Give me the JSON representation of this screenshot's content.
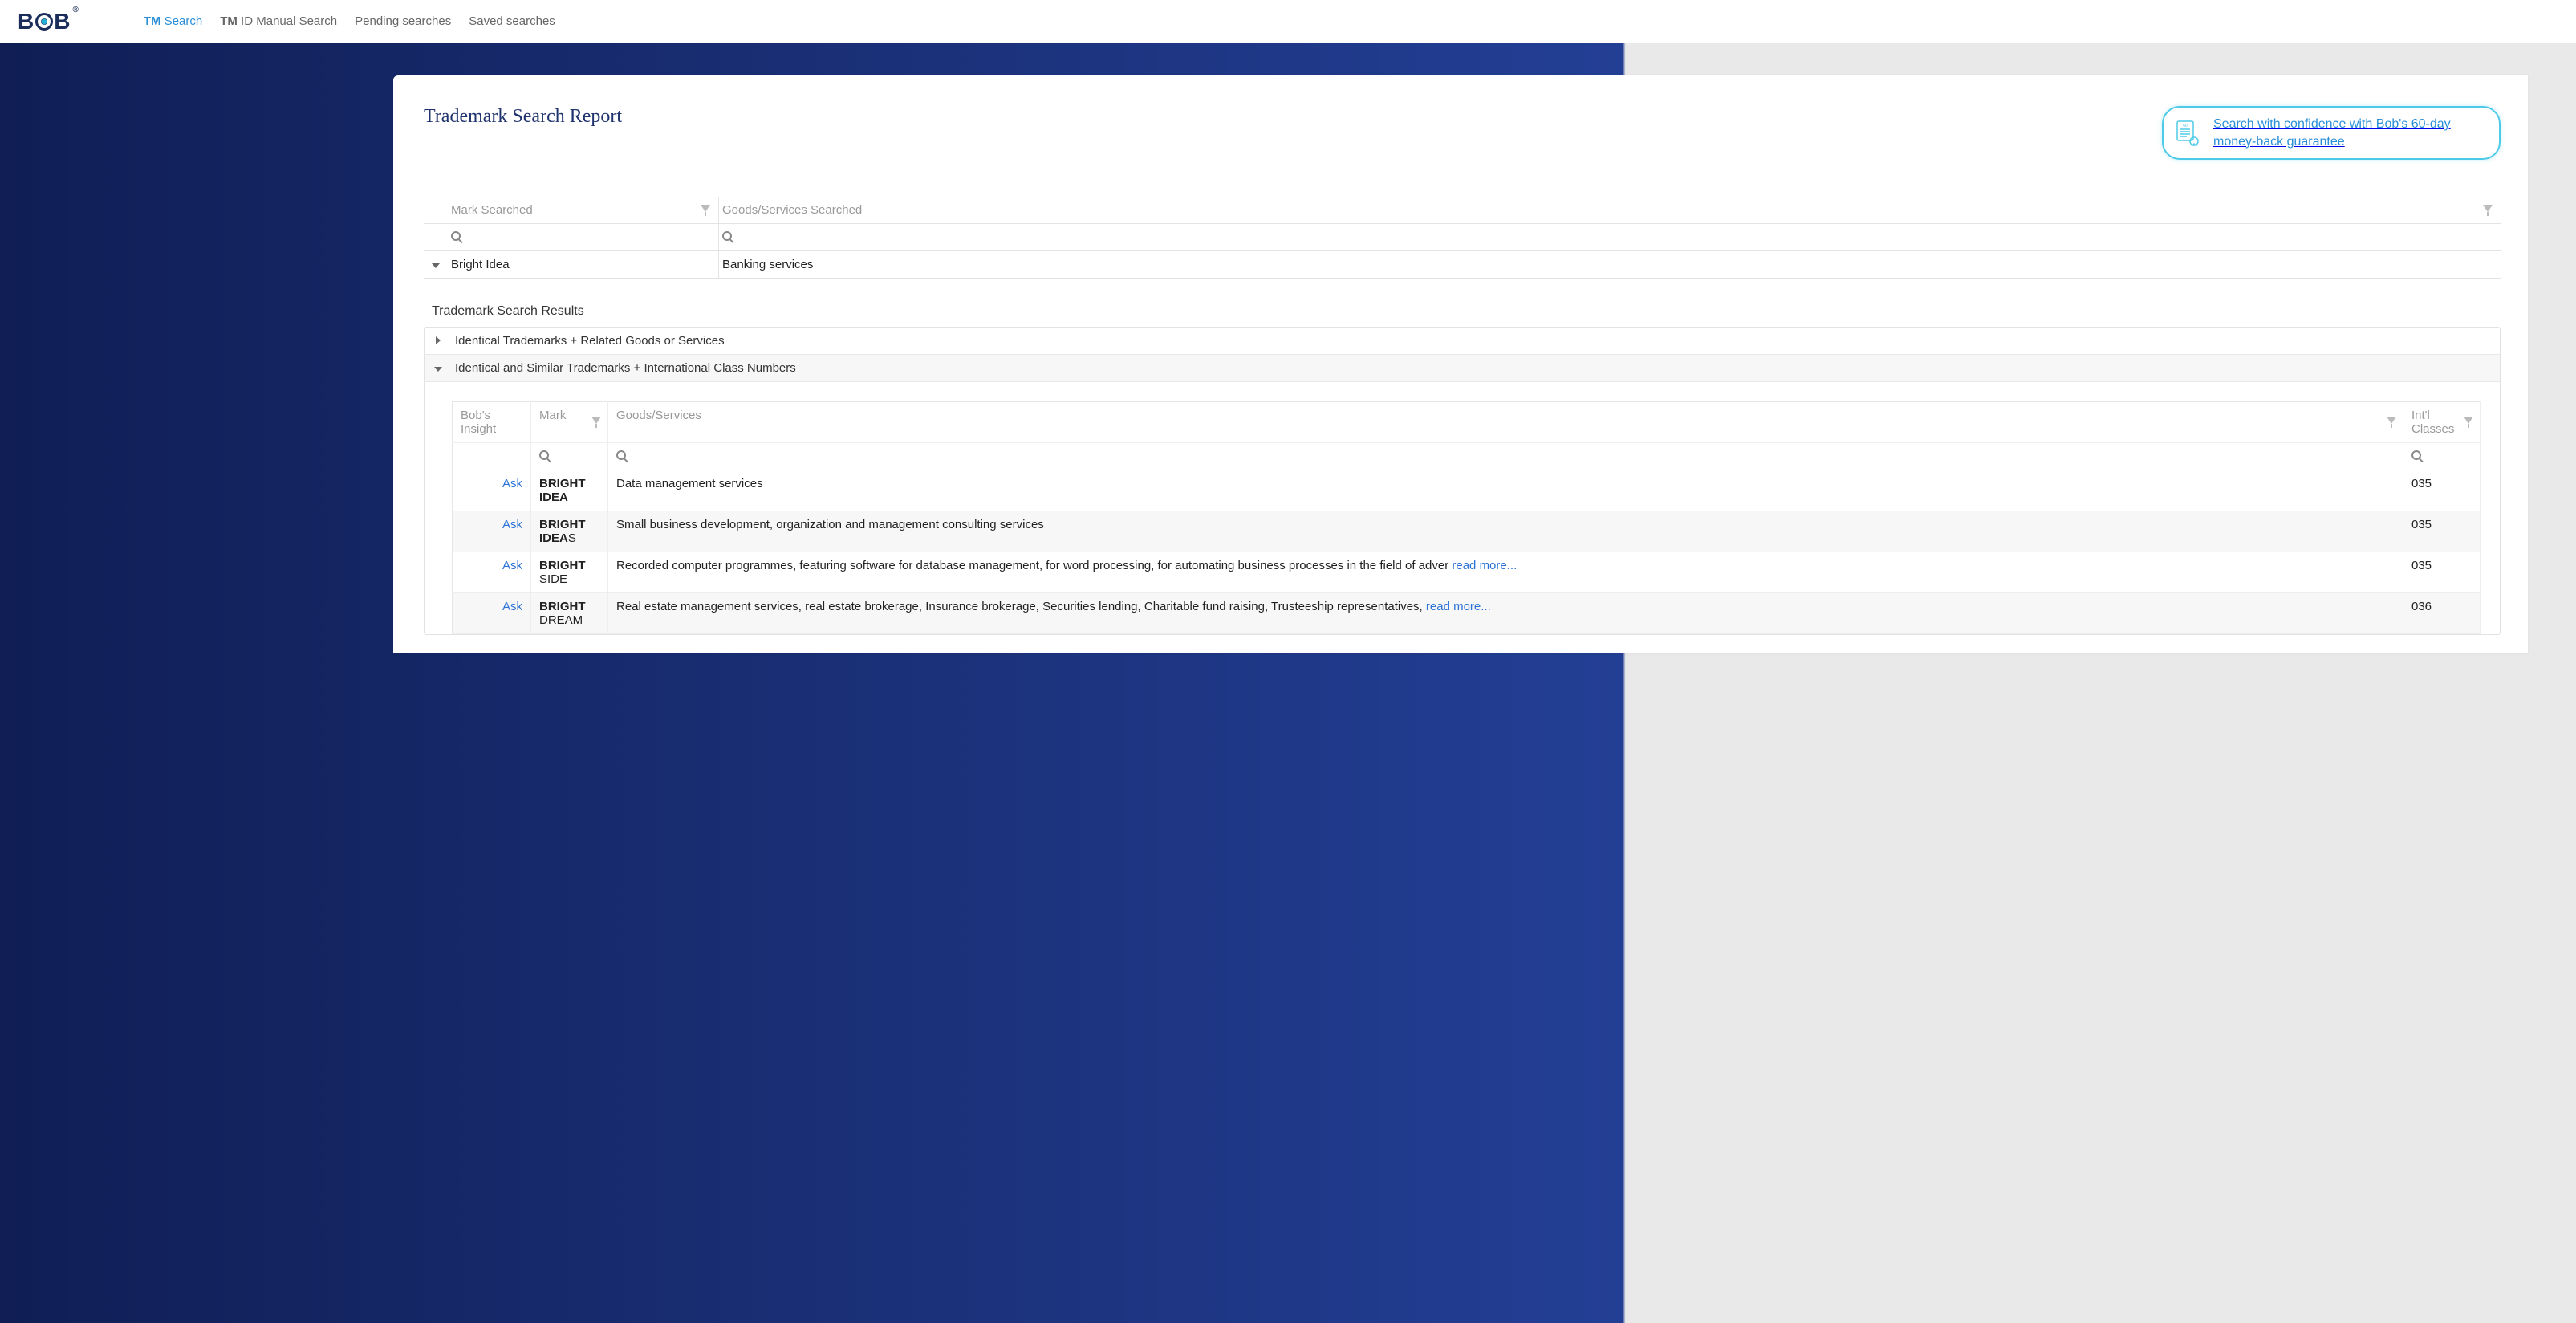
{
  "logo": {
    "text_left": "B",
    "text_right": "B",
    "reg": "®"
  },
  "nav": [
    {
      "tm": "TM",
      "rest": " Search",
      "active": true
    },
    {
      "tm": "TM",
      "rest": " ID Manual Search",
      "active": false
    },
    {
      "tm": "",
      "rest": "Pending searches",
      "active": false
    },
    {
      "tm": "",
      "rest": "Saved searches",
      "active": false
    }
  ],
  "report": {
    "title": "Trademark Search Report",
    "guarantee_text": "Search with confidence with Bob's 60-day money-back guarantee"
  },
  "searchTable": {
    "markHeader": "Mark Searched",
    "gsHeader": "Goods/Services Searched",
    "markValue": "Bright Idea",
    "gsValue": "Banking services"
  },
  "results": {
    "title": "Trademark Search Results",
    "group1": "Identical Trademarks + Related Goods or Services",
    "group2": "Identical and Similar Trademarks + International Class Numbers",
    "cols": {
      "insight": "Bob's Insight",
      "mark": "Mark",
      "gs": "Goods/Services",
      "classes": "Int'l Classes"
    },
    "askLabel": "Ask",
    "readMore": "read more...",
    "rows": [
      {
        "mark_bold": "BRIGHT IDEA",
        "mark_rest": "",
        "gs": "Data management services",
        "cls": "035"
      },
      {
        "mark_bold": "BRIGHT IDEA",
        "mark_rest": "S",
        "gs": "Small business development, organization and management consulting services",
        "cls": "035"
      },
      {
        "mark_bold": "BRIGHT",
        "mark_rest": " SIDE",
        "gs": "Recorded computer programmes, featuring software for database management, for word processing, for automating business processes in the field of adver ",
        "cls": "035",
        "hasReadMore": true
      },
      {
        "mark_bold": "BRIGHT",
        "mark_rest": " DREAM",
        "gs": "Real estate management services, real estate brokerage, Insurance brokerage, Securities lending, Charitable fund raising, Trusteeship representatives, ",
        "cls": "036",
        "hasReadMore": true
      }
    ]
  }
}
